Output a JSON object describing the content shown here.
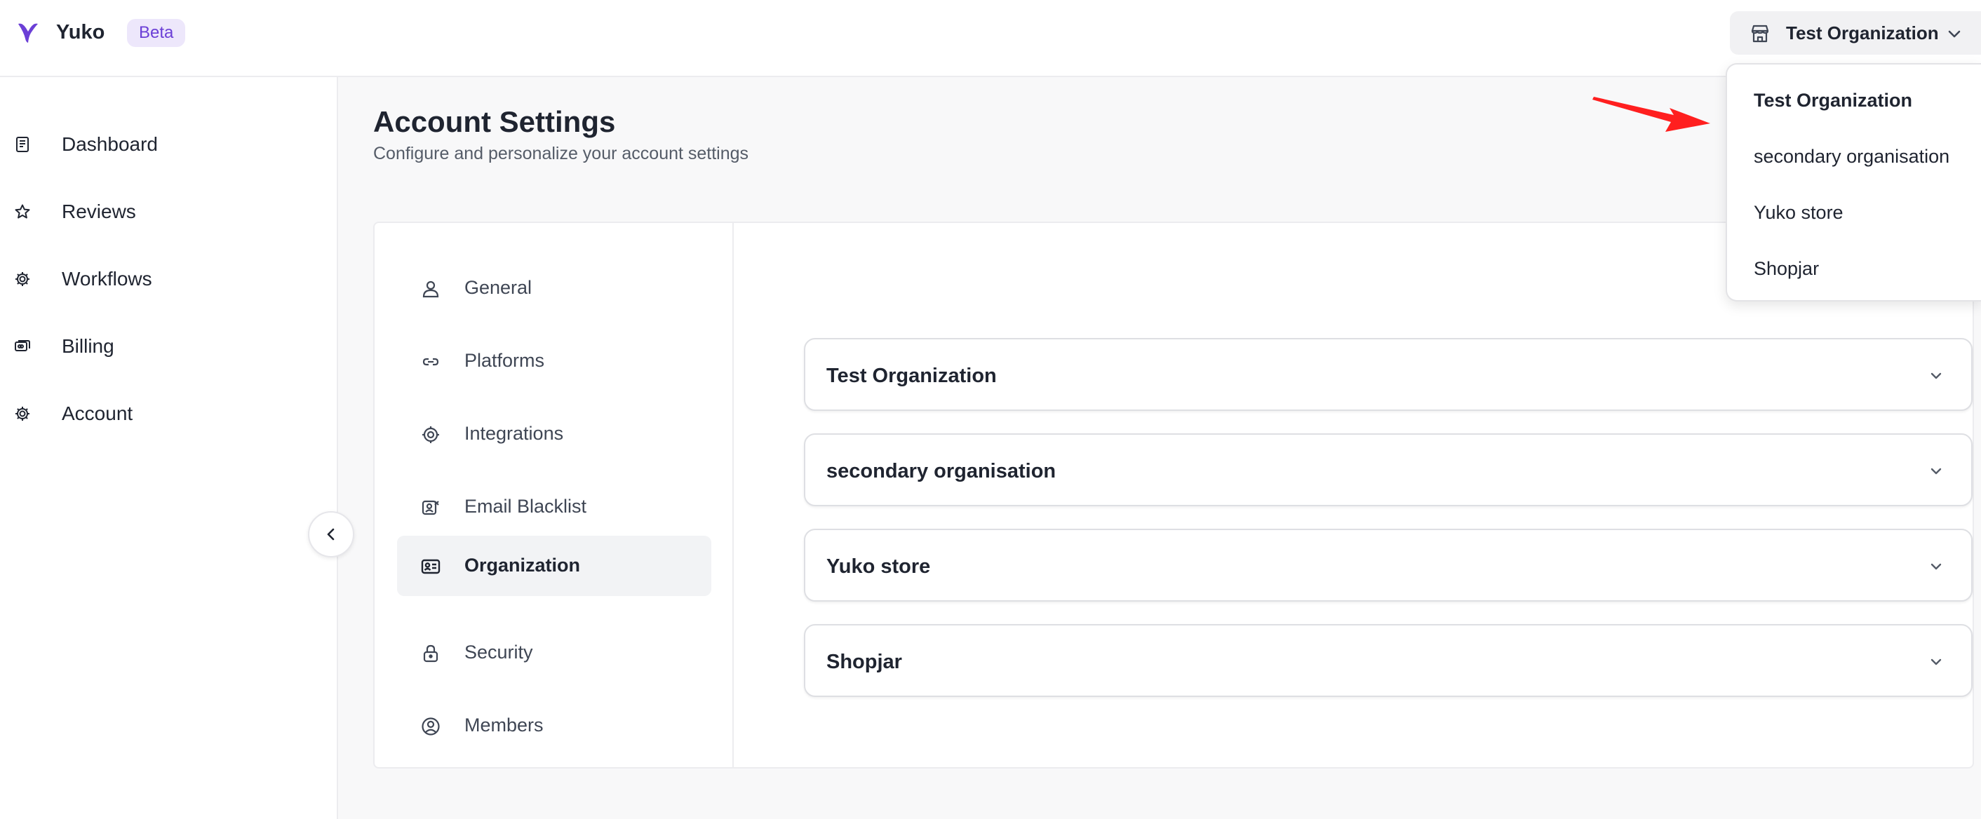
{
  "app": {
    "name": "Yuko",
    "badge": "Beta",
    "accent_color": "#6b3fd6"
  },
  "header": {
    "org_switcher": {
      "selected": "Test Organization",
      "icon": "store-icon"
    }
  },
  "sidebar": {
    "items": [
      {
        "label": "Dashboard",
        "icon": "book-icon"
      },
      {
        "label": "Reviews",
        "icon": "star-icon"
      },
      {
        "label": "Workflows",
        "icon": "gear-icon"
      },
      {
        "label": "Billing",
        "icon": "cards-icon"
      },
      {
        "label": "Account",
        "icon": "gear-icon"
      }
    ]
  },
  "page": {
    "title": "Account Settings",
    "subtitle": "Configure and personalize your account settings"
  },
  "settings_nav": {
    "items": [
      {
        "label": "General",
        "icon": "user-icon"
      },
      {
        "label": "Platforms",
        "icon": "link-icon"
      },
      {
        "label": "Integrations",
        "icon": "gear-icon"
      },
      {
        "label": "Email Blacklist",
        "icon": "contact-block-icon"
      },
      {
        "label": "Organization",
        "icon": "id-card-icon",
        "active": true
      },
      {
        "label": "Security",
        "icon": "lock-icon"
      },
      {
        "label": "Members",
        "icon": "user-circle-icon"
      }
    ]
  },
  "organizations": [
    {
      "name": "Test Organization"
    },
    {
      "name": "secondary organisation"
    },
    {
      "name": "Yuko store"
    },
    {
      "name": "Shopjar"
    }
  ],
  "dropdown": {
    "items": [
      {
        "label": "Test Organization",
        "selected": true
      },
      {
        "label": "secondary organisation"
      },
      {
        "label": "Yuko store"
      },
      {
        "label": "Shopjar"
      }
    ]
  },
  "annotation": {
    "arrow_color": "#ff1f1f"
  }
}
